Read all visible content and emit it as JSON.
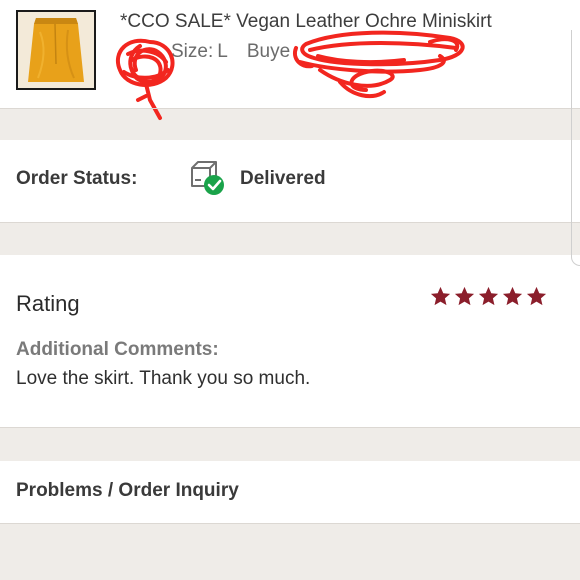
{
  "listing": {
    "title": "*CCO SALE* Vegan Leather Ochre Miniskirt",
    "size_label": "Size:",
    "size_value": "L",
    "buyer_label": "Buye",
    "thumbnail_icon": "ochre-miniskirt-photo"
  },
  "order_status": {
    "label": "Order Status:",
    "value": "Delivered",
    "icon": "delivered-package-check-icon",
    "status_color": "#1aa34a"
  },
  "rating": {
    "heading": "Rating",
    "stars": 5,
    "max_stars": 5,
    "star_color": "#8b1e2b",
    "comments_label": "Additional Comments:",
    "comments_text": "Love the skirt. Thank you so much."
  },
  "problems": {
    "label": "Problems / Order Inquiry"
  },
  "colors": {
    "background": "#efece8",
    "card": "#ffffff",
    "redaction": "#f2261f"
  }
}
